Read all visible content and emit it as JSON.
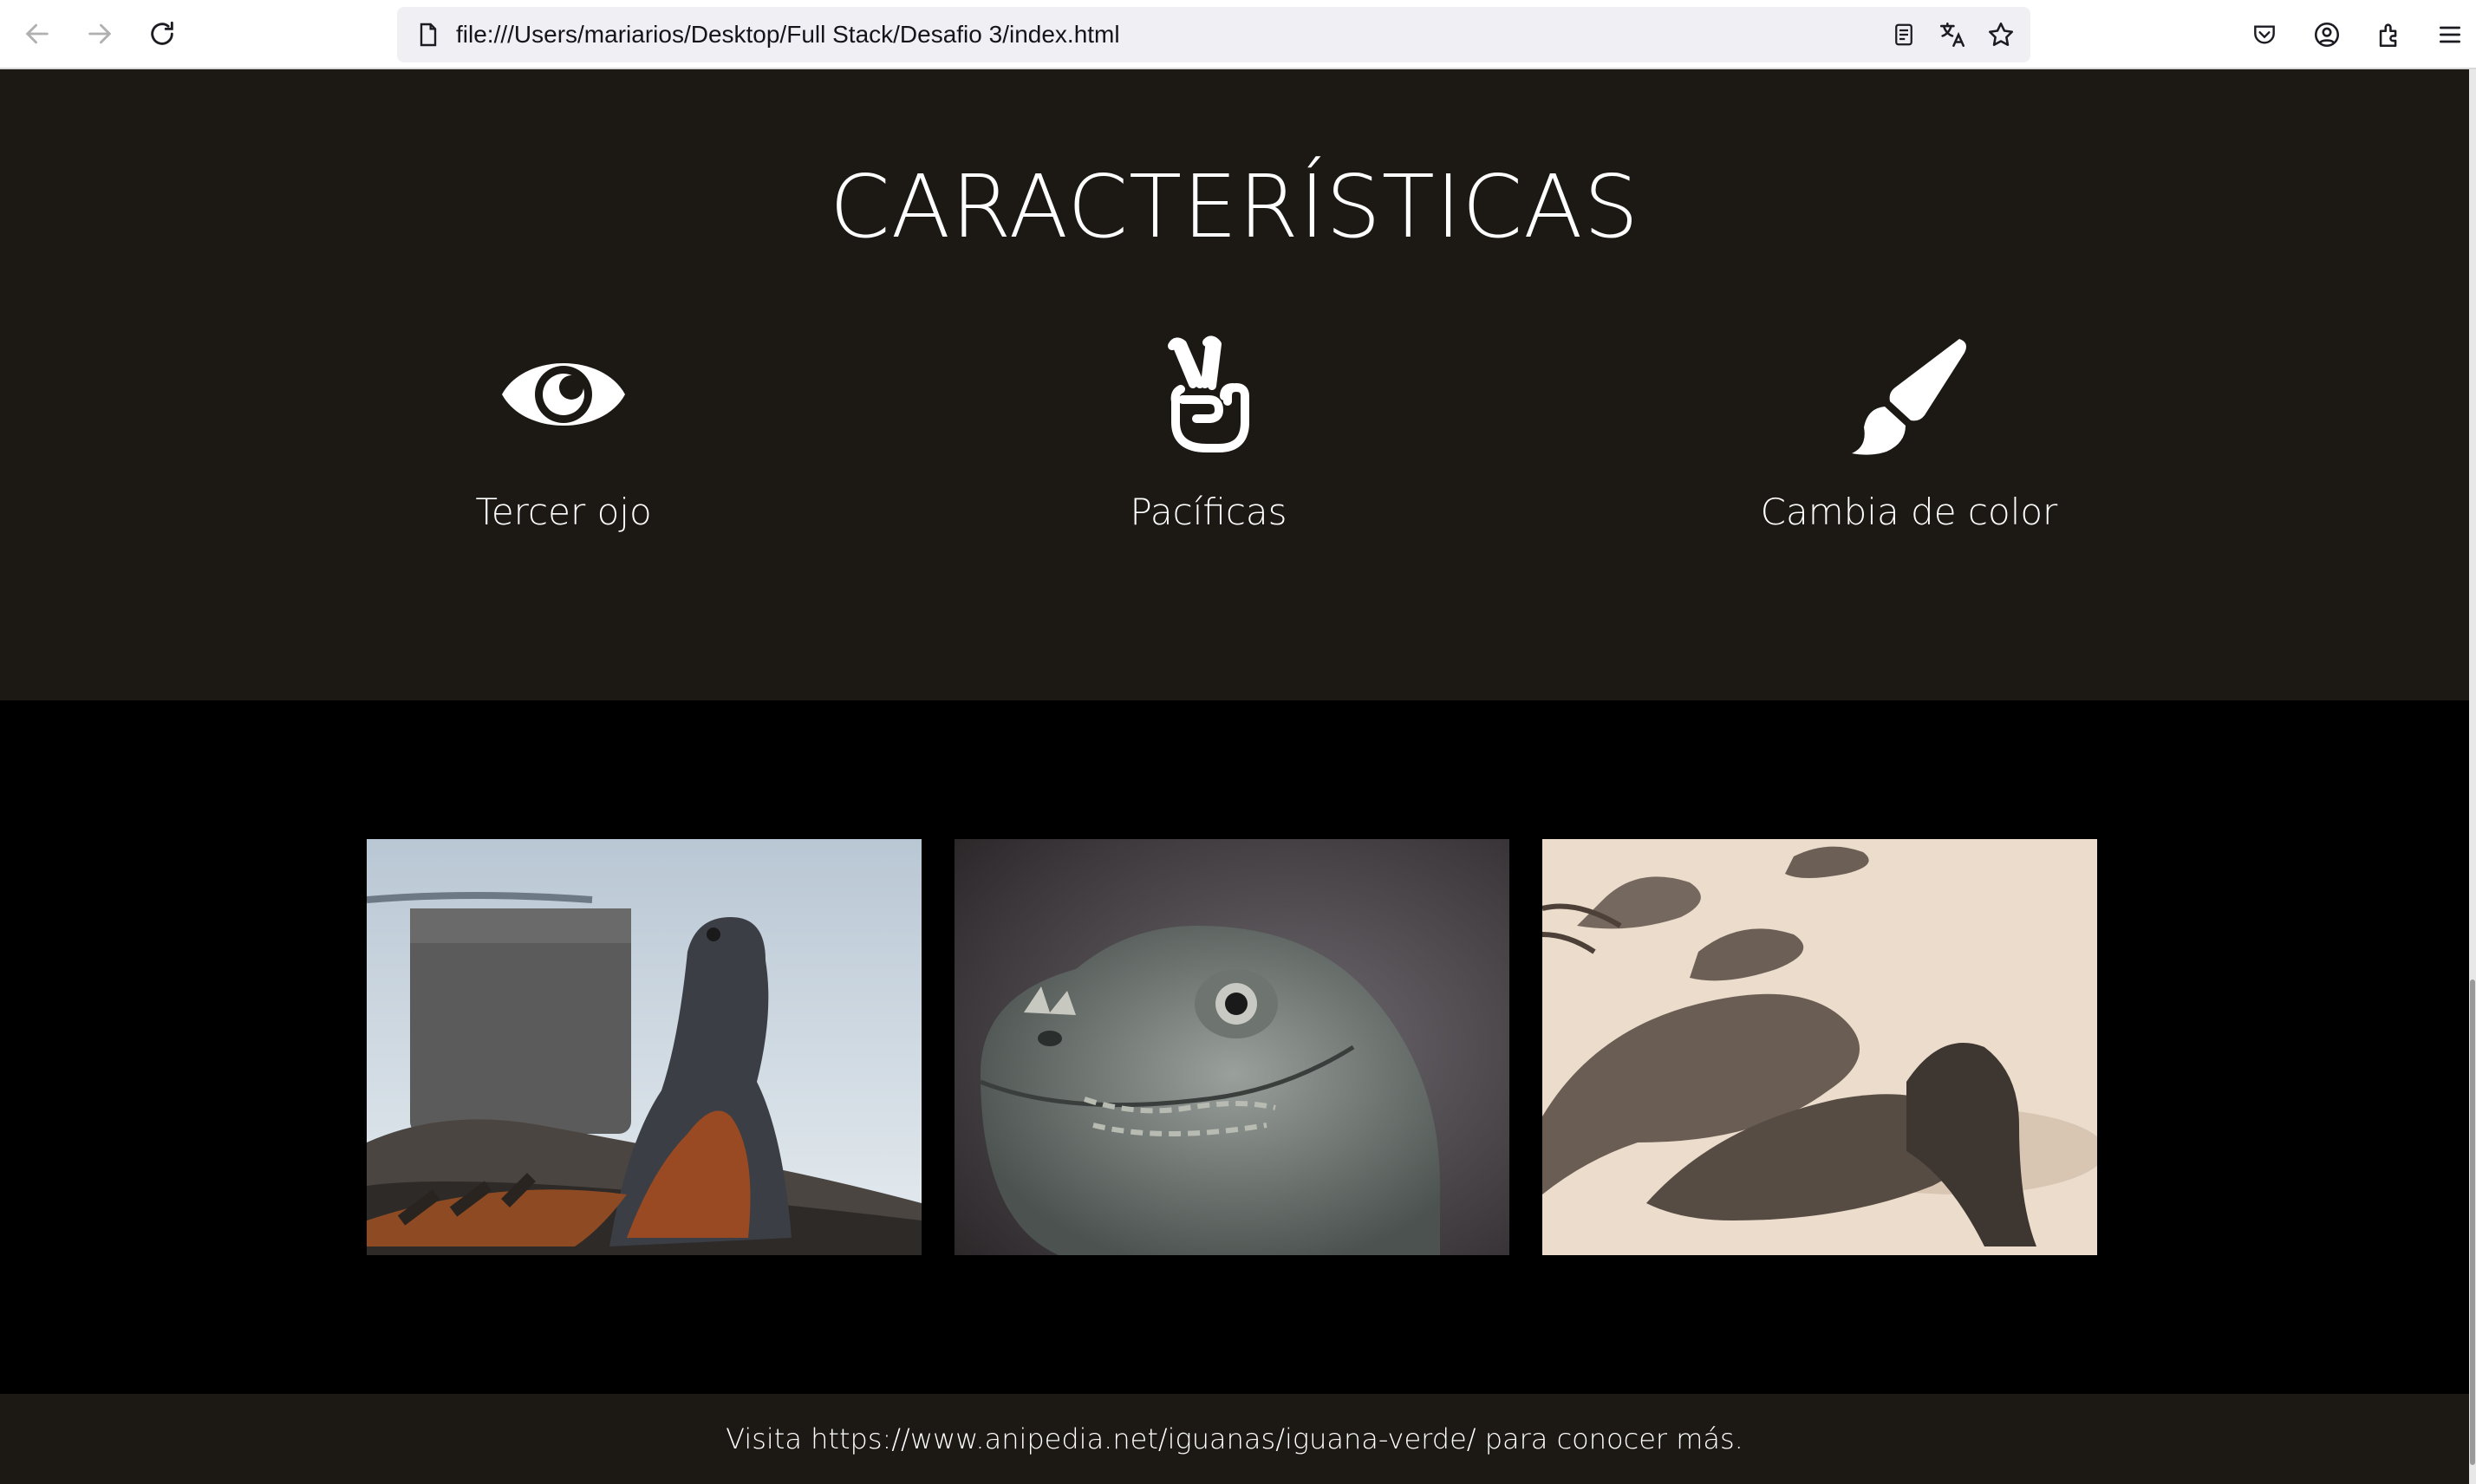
{
  "browser": {
    "url": "file:///Users/mariarios/Desktop/Full Stack/Desafio 3/index.html",
    "icons": [
      "back-arrow-icon",
      "forward-arrow-icon",
      "reload-icon",
      "page-icon",
      "reader-view-icon",
      "translate-icon",
      "bookmark-star-icon",
      "pocket-icon",
      "account-icon",
      "extensions-icon",
      "menu-icon"
    ]
  },
  "features": {
    "title": "CARACTERÍSTICAS",
    "items": [
      {
        "label": "Tercer ojo",
        "icon": "eye-icon"
      },
      {
        "label": "Pacíficas",
        "icon": "peace-hand-icon"
      },
      {
        "label": "Cambia de color",
        "icon": "paintbrush-icon"
      }
    ]
  },
  "gallery": {
    "photos": [
      {
        "subject": "iguana-on-rock-by-water"
      },
      {
        "subject": "iguana-head-closeup"
      },
      {
        "subject": "iguanas-on-sand"
      }
    ]
  },
  "footer": {
    "text": "Visita https://www.anipedia.net/iguanas/iguana-verde/ para conocer más."
  },
  "colors": {
    "section_bg": "#1c1915",
    "gallery_bg": "#000000",
    "text": "#ffffff"
  }
}
